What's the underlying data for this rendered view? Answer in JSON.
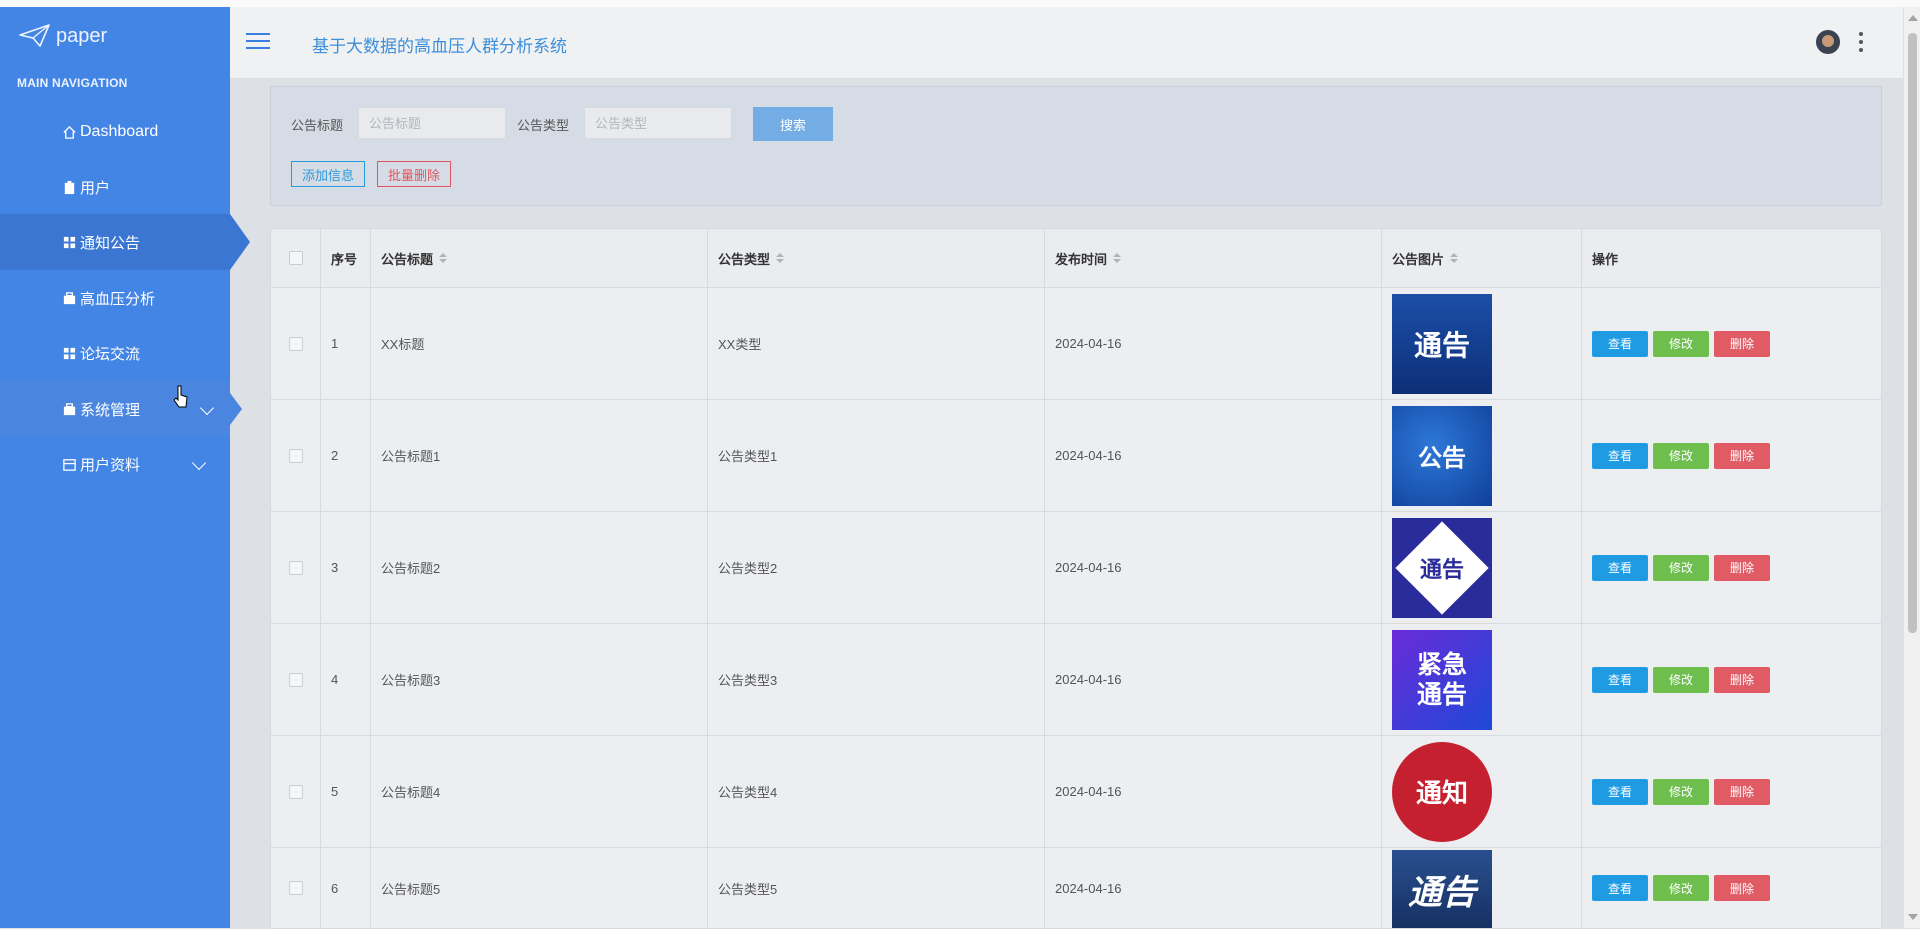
{
  "brand": {
    "name": "paper"
  },
  "sidebar": {
    "header": "MAIN NAVIGATION",
    "items": [
      {
        "label": "Dashboard",
        "icon": "home-icon"
      },
      {
        "label": "用户",
        "icon": "clipboard-icon"
      },
      {
        "label": "通知公告",
        "icon": "grid-icon",
        "active": true
      },
      {
        "label": "高血压分析",
        "icon": "briefcase-icon"
      },
      {
        "label": "论坛交流",
        "icon": "grid-icon"
      },
      {
        "label": "系统管理",
        "icon": "briefcase-icon",
        "expandable": true
      },
      {
        "label": "用户资料",
        "icon": "calendar-icon",
        "expandable": true
      }
    ]
  },
  "header": {
    "title": "基于大数据的高血压人群分析系统"
  },
  "search": {
    "title_label": "公告标题",
    "title_placeholder": "公告标题",
    "type_label": "公告类型",
    "type_placeholder": "公告类型",
    "search_button": "搜索",
    "add_button": "添加信息",
    "batch_delete_button": "批量删除"
  },
  "table": {
    "columns": [
      "序号",
      "公告标题",
      "公告类型",
      "发布时间",
      "公告图片",
      "操作"
    ],
    "rows": [
      {
        "index": "1",
        "title": "XX标题",
        "type": "XX类型",
        "date": "2024-04-16",
        "image_text": "通告"
      },
      {
        "index": "2",
        "title": "公告标题1",
        "type": "公告类型1",
        "date": "2024-04-16",
        "image_text": "公告"
      },
      {
        "index": "3",
        "title": "公告标题2",
        "type": "公告类型2",
        "date": "2024-04-16",
        "image_text": "通告"
      },
      {
        "index": "4",
        "title": "公告标题3",
        "type": "公告类型3",
        "date": "2024-04-16",
        "image_text": "紧急通告"
      },
      {
        "index": "5",
        "title": "公告标题4",
        "type": "公告类型4",
        "date": "2024-04-16",
        "image_text": "通知"
      },
      {
        "index": "6",
        "title": "公告标题5",
        "type": "公告类型5",
        "date": "2024-04-16",
        "image_text": "通告"
      }
    ],
    "actions": {
      "view": "查看",
      "edit": "修改",
      "delete": "删除"
    }
  },
  "colors": {
    "sidebar": "#4385e4",
    "accent": "#1e9be2",
    "success": "#6fbf4f",
    "danger": "#e05b63"
  }
}
